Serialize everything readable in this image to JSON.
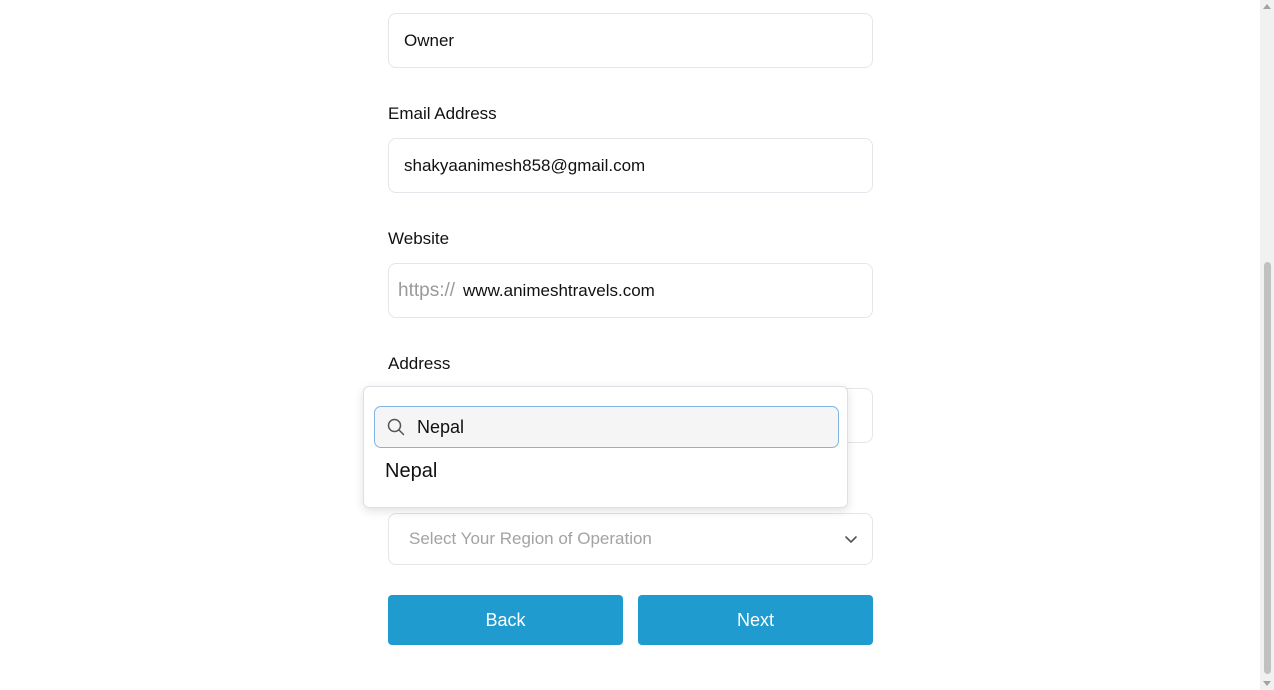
{
  "form": {
    "role_value": "Owner",
    "email_label": "Email Address",
    "email_value": "shakyaanimesh858@gmail.com",
    "website_label": "Website",
    "website_prefix": "https://",
    "website_value": "www.animeshtravels.com",
    "address_label": "Address",
    "region_placeholder": "Select Your Region of Operation"
  },
  "dropdown": {
    "search_value": "Nepal",
    "options": [
      "Nepal"
    ]
  },
  "buttons": {
    "back_label": "Back",
    "next_label": "Next"
  },
  "colors": {
    "primary": "#1f9bcf",
    "border": "#e3e6ea",
    "placeholder": "#a3a3a3",
    "search_border": "#7fb5e6"
  },
  "icons": {
    "search": "search-icon",
    "chevron": "chevron-down-icon"
  }
}
